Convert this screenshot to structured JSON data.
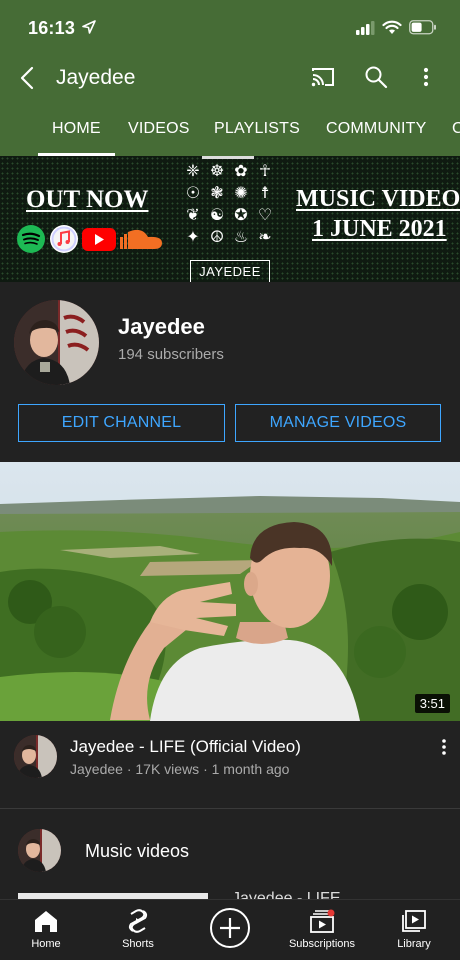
{
  "status_bar": {
    "time": "16:13"
  },
  "app_bar": {
    "title": "Jayedee"
  },
  "tabs": [
    {
      "label": "HOME",
      "active": true
    },
    {
      "label": "VIDEOS"
    },
    {
      "label": "PLAYLISTS"
    },
    {
      "label": "COMMUNITY"
    },
    {
      "label": "C"
    }
  ],
  "banner": {
    "left_text": "OUT NOW",
    "right_line1": "MUSIC VIDEO",
    "right_line2": "1 JUNE 2021",
    "brand": "JAYEDEE",
    "services": [
      "spotify-icon",
      "apple-music-icon",
      "youtube-icon",
      "soundcloud-icon"
    ]
  },
  "channel": {
    "name": "Jayedee",
    "subscribers": "194 subscribers",
    "edit_button": "EDIT CHANNEL",
    "manage_button": "MANAGE VIDEOS"
  },
  "video": {
    "duration": "3:51",
    "title": "Jayedee - LIFE (Official Video)",
    "meta": "Jayedee · 17K views · 1 month ago"
  },
  "section": {
    "title": "Music videos",
    "peek_title": "Jayedee - LIFE"
  },
  "bottom_nav": [
    {
      "label": "Home",
      "icon": "home-icon",
      "active": true
    },
    {
      "label": "Shorts",
      "icon": "shorts-icon"
    },
    {
      "label": "",
      "icon": "create-icon"
    },
    {
      "label": "Subscriptions",
      "icon": "subscriptions-icon"
    },
    {
      "label": "Library",
      "icon": "library-icon"
    }
  ],
  "colors": {
    "header_green": "#466c36",
    "accent_blue": "#3ea6ff",
    "background": "#222222"
  }
}
